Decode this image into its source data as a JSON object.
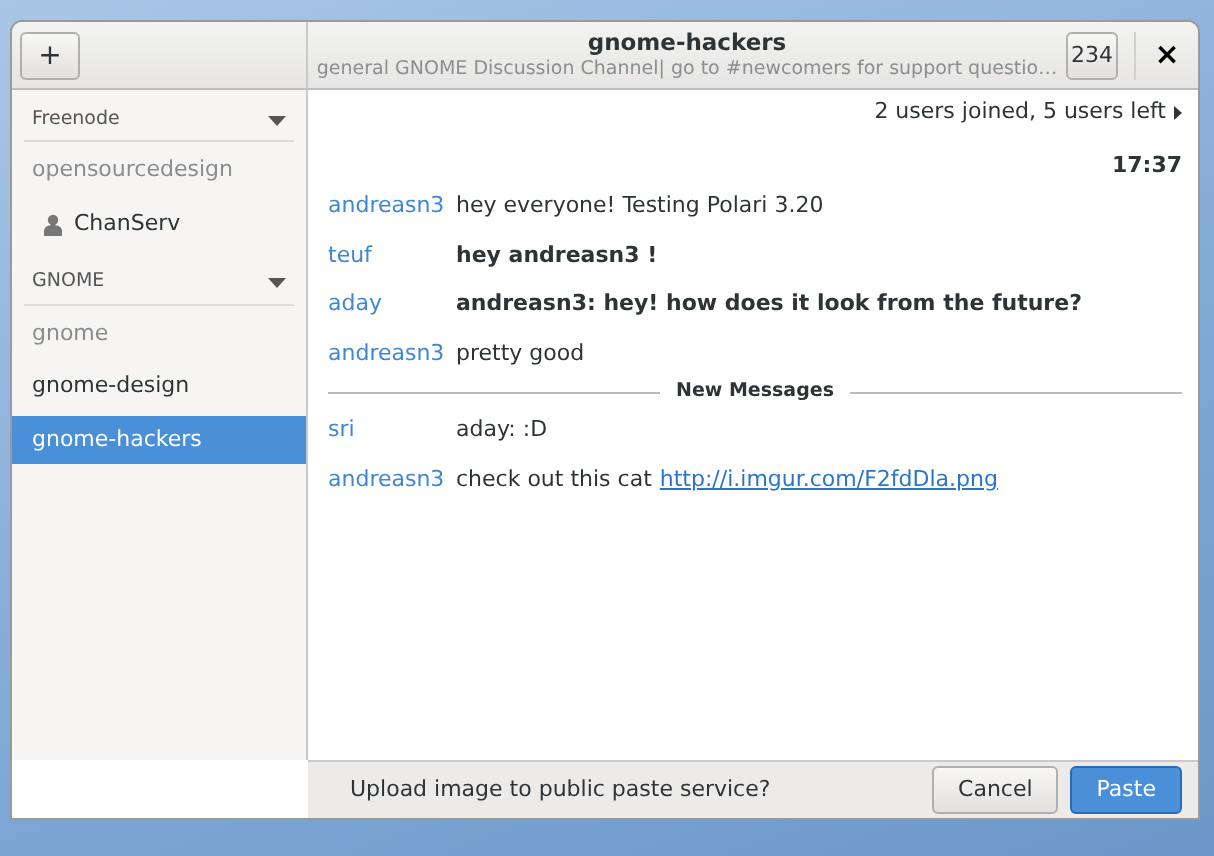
{
  "header": {
    "add_button": "+",
    "title": "gnome-hackers",
    "topic": "general GNOME Discussion Channel| go to #newcomers for support questio…",
    "user_count": "234",
    "close_button": "×"
  },
  "sidebar": {
    "sections": [
      {
        "name": "Freenode",
        "expanded": true,
        "rooms": [
          {
            "name": "opensourcedesign",
            "kind": "channel",
            "muted": true,
            "selected": false
          },
          {
            "name": "ChanServ",
            "kind": "user",
            "muted": false,
            "selected": false
          }
        ]
      },
      {
        "name": "GNOME",
        "expanded": true,
        "rooms": [
          {
            "name": "gnome",
            "kind": "channel",
            "muted": true,
            "selected": false
          },
          {
            "name": "gnome-design",
            "kind": "channel",
            "muted": false,
            "selected": false
          },
          {
            "name": "gnome-hackers",
            "kind": "channel",
            "muted": false,
            "selected": true
          }
        ]
      }
    ]
  },
  "chat": {
    "status": "2 users joined, 5 users left",
    "time": "17:37",
    "messages": [
      {
        "kind": "message",
        "nick": "andreasn3",
        "text": "hey everyone! Testing Polari 3.20",
        "highlight": false
      },
      {
        "kind": "message",
        "nick": "teuf",
        "text": "hey andreasn3 !",
        "highlight": true
      },
      {
        "kind": "message",
        "nick": "aday",
        "text": "andreasn3: hey! how does it look from the future?",
        "highlight": true
      },
      {
        "kind": "message",
        "nick": "andreasn3",
        "text": "pretty good",
        "highlight": false
      },
      {
        "kind": "divider",
        "text": "New Messages"
      },
      {
        "kind": "message",
        "nick": "sri",
        "text": "aday: :D",
        "highlight": false
      },
      {
        "kind": "message",
        "nick": "andreasn3",
        "text": "check out this cat",
        "link": "http://i.imgur.com/F2fdDla.png",
        "highlight": false
      }
    ]
  },
  "paste_bar": {
    "prompt": "Upload image to public paste service?",
    "buttons": [
      {
        "label": "Cancel",
        "kind": "secondary"
      },
      {
        "label": "Paste",
        "kind": "primary"
      }
    ]
  }
}
